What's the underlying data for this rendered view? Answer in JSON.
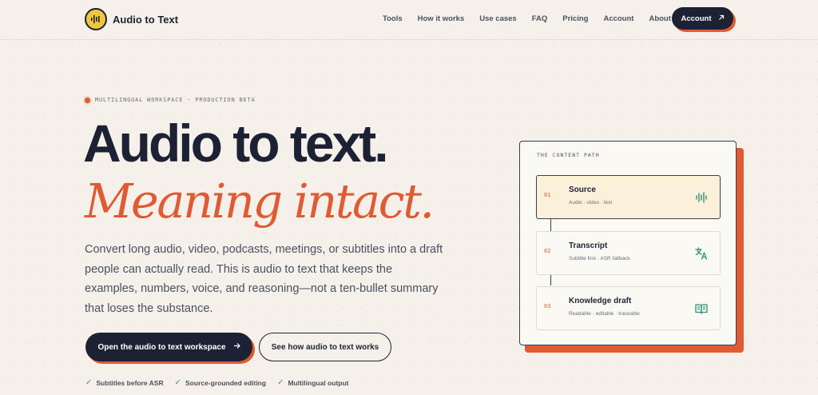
{
  "brand": {
    "name": "Audio to Text",
    "logo_color": "#f2c53d"
  },
  "nav": {
    "items": [
      "Tools",
      "How it works",
      "Use cases",
      "FAQ",
      "Pricing",
      "Account",
      "About"
    ],
    "cta_label": "Account"
  },
  "hero": {
    "eyebrow": "MULTILINGUAL WORKSPACE · PRODUCTION BETA",
    "headline": "Audio to text.",
    "headline_accent": "Meaning intact.",
    "description": "Convert long audio, video, podcasts, meetings, or subtitles into a draft people can actually read. This is audio to text that keeps the examples, numbers, voice, and reasoning—not a ten-bullet summary that loses the substance.",
    "primary_cta": "Open the audio to text workspace",
    "secondary_cta": "See how audio to text works",
    "features": [
      "Subtitles before ASR",
      "Source-grounded editing",
      "Multilingual output"
    ]
  },
  "content_path": {
    "title": "THE CONTENT PATH",
    "steps": [
      {
        "num": "01",
        "title": "Source",
        "subtitle": "Audio · video · text",
        "icon": "waveform-icon"
      },
      {
        "num": "02",
        "title": "Transcript",
        "subtitle": "Subtitle first · ASR fallback",
        "icon": "translate-icon"
      },
      {
        "num": "03",
        "title": "Knowledge draft",
        "subtitle": "Readable · editable · traceable",
        "icon": "book-icon"
      }
    ]
  },
  "colors": {
    "navy": "#1c2233",
    "accent": "#e05a33",
    "teal": "#2f8f7a",
    "background": "#f5f1ea"
  }
}
